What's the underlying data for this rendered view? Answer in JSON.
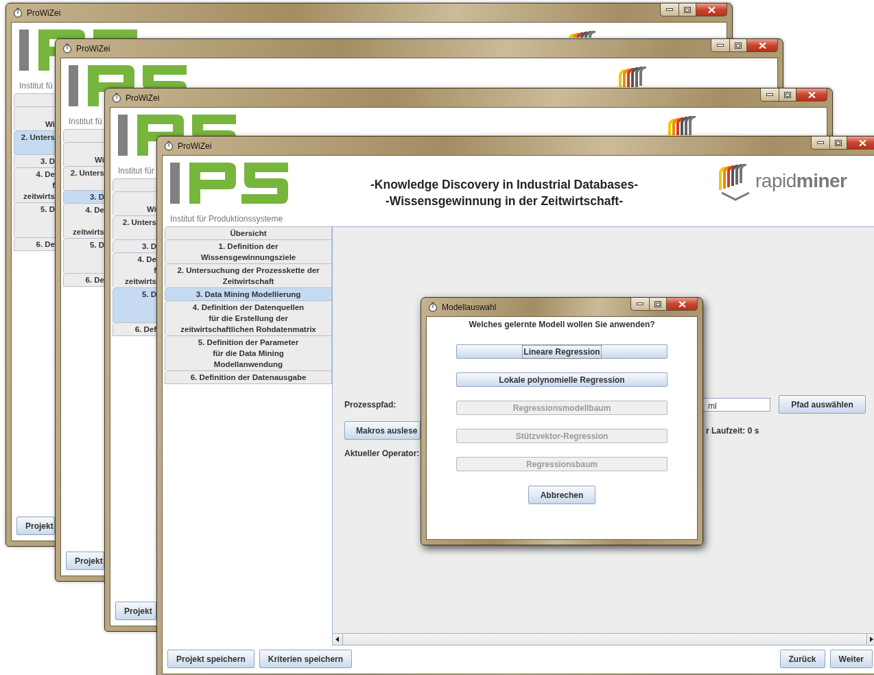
{
  "windows": [
    {
      "title": "ProWiZei",
      "institute": "Institut fü",
      "sidebar": [
        {
          "lines": [
            {
              "kind": "covered"
            }
          ],
          "selected": false
        },
        {
          "lines": [
            {
              "kind": "covered"
            },
            {
              "kind": "text",
              "text": "Wi"
            }
          ],
          "selected": false
        },
        {
          "lines": [
            {
              "kind": "text",
              "text": "2. Unters"
            },
            {
              "kind": "covered"
            }
          ],
          "selected": true
        },
        {
          "lines": [
            {
              "kind": "text",
              "text": "3. D"
            }
          ],
          "selected": false
        },
        {
          "lines": [
            {
              "kind": "text",
              "text": "4. De"
            },
            {
              "kind": "text",
              "text": "f"
            },
            {
              "kind": "text",
              "text": "zeitwirts"
            }
          ],
          "selected": false
        },
        {
          "lines": [
            {
              "kind": "text",
              "text": "5. D"
            },
            {
              "kind": "covered"
            },
            {
              "kind": "covered"
            }
          ],
          "selected": false
        },
        {
          "lines": [
            {
              "kind": "text",
              "text": "6. De"
            }
          ],
          "selected": false
        }
      ],
      "footer_button": "Projekt"
    },
    {
      "title": "ProWiZei",
      "institute": "Institut fü",
      "sidebar": [
        {
          "lines": [
            {
              "kind": "covered"
            }
          ],
          "selected": false
        },
        {
          "lines": [
            {
              "kind": "covered"
            },
            {
              "kind": "text",
              "text": "Wi"
            }
          ],
          "selected": false
        },
        {
          "lines": [
            {
              "kind": "text",
              "text": "2. Unters"
            },
            {
              "kind": "covered"
            }
          ],
          "selected": false
        },
        {
          "lines": [
            {
              "kind": "text",
              "text": "3. D"
            }
          ],
          "selected": true
        },
        {
          "lines": [
            {
              "kind": "text",
              "text": "4. De"
            },
            {
              "kind": "covered"
            },
            {
              "kind": "text",
              "text": "zeitwirts"
            }
          ],
          "selected": false
        },
        {
          "lines": [
            {
              "kind": "text",
              "text": "5. D"
            },
            {
              "kind": "covered"
            },
            {
              "kind": "covered"
            }
          ],
          "selected": false
        },
        {
          "lines": [
            {
              "kind": "text",
              "text": "6. De"
            }
          ],
          "selected": false
        }
      ],
      "footer_button": "Projekt"
    },
    {
      "title": "ProWiZei",
      "institute": "Institut für",
      "sidebar": [
        {
          "lines": [
            {
              "kind": "covered"
            }
          ],
          "selected": false
        },
        {
          "lines": [
            {
              "kind": "covered"
            },
            {
              "kind": "text",
              "text": "Wi"
            }
          ],
          "selected": false
        },
        {
          "lines": [
            {
              "kind": "text",
              "text": "2. Unters"
            },
            {
              "kind": "covered"
            }
          ],
          "selected": false
        },
        {
          "lines": [
            {
              "kind": "text",
              "text": "3. D"
            }
          ],
          "selected": false
        },
        {
          "lines": [
            {
              "kind": "text",
              "text": "4. De"
            },
            {
              "kind": "text",
              "text": "f"
            },
            {
              "kind": "text",
              "text": "zeitwirts"
            }
          ],
          "selected": false
        },
        {
          "lines": [
            {
              "kind": "text",
              "text": "5. D"
            },
            {
              "kind": "covered"
            },
            {
              "kind": "covered"
            }
          ],
          "selected": true
        },
        {
          "lines": [
            {
              "kind": "text",
              "text": "6. Def"
            }
          ],
          "selected": false
        }
      ],
      "footer_button": "Projekt"
    }
  ],
  "front": {
    "title": "ProWiZei",
    "institute": "Institut für Produktionssysteme",
    "heading": [
      "-Knowledge Discovery in Industrial Databases-",
      "-Wissensgewinnung in der Zeitwirtschaft-"
    ],
    "brand": "rapid**miner**",
    "sidebar": [
      {
        "lines": [
          "Übersicht"
        ],
        "selected": false
      },
      {
        "lines": [
          "1. Definition der",
          "Wissensgewinnungsziele"
        ],
        "selected": false
      },
      {
        "lines": [
          "2. Untersuchung der Prozesskette der",
          "Zeitwirtschaft"
        ],
        "selected": false
      },
      {
        "lines": [
          "3. Data Mining Modellierung"
        ],
        "selected": true
      },
      {
        "lines": [
          "4. Definition der Datenquellen",
          "für die Erstellung der",
          "zeitwirtschaftlichen Rohdatenmatrix"
        ],
        "selected": false
      },
      {
        "lines": [
          "5. Definition der Parameter",
          "für die Data Mining",
          "Modellanwendung"
        ],
        "selected": false
      },
      {
        "lines": [
          "6. Definition der Datenausgabe"
        ],
        "selected": false
      }
    ],
    "process_path": {
      "label": "Prozesspfad:",
      "value": "ml",
      "button": "Pfad auswählen"
    },
    "read_macros_button": "Makros auslese",
    "runtime": "r Laufzeit: 0 s",
    "current_operator": "Aktueller Operator:",
    "footer_buttons_left": [
      "Projekt speichern",
      "Kriterien speichern"
    ],
    "footer_buttons_right": [
      "Zurück",
      "Weiter"
    ]
  },
  "dialog": {
    "title": "Modellauswahl",
    "question": "Welches gelernte Modell wollen Sie anwenden?",
    "options": [
      {
        "label": "Lineare Regression",
        "disabled": false,
        "focused": true
      },
      {
        "label": "Lokale polynomielle Regression",
        "disabled": false,
        "focused": false
      },
      {
        "label": "Regressionsmodellbaum",
        "disabled": true,
        "focused": false
      },
      {
        "label": "Stützvektor-Regression",
        "disabled": true,
        "focused": false
      },
      {
        "label": "Regressionsbaum",
        "disabled": true,
        "focused": false
      }
    ],
    "cancel": "Abbrechen"
  }
}
